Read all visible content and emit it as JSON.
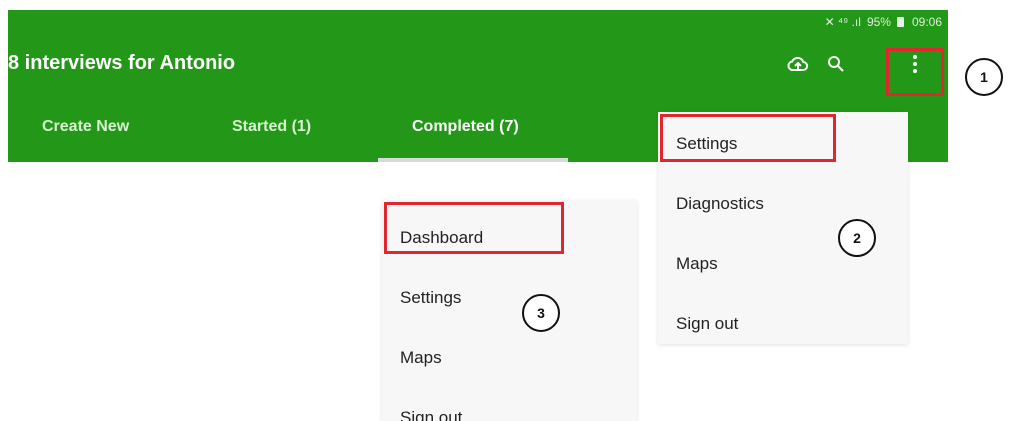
{
  "statusbar": {
    "battery": "95%",
    "time": "09:06"
  },
  "header": {
    "title": "8 interviews for Antonio"
  },
  "tabs": [
    {
      "label": "Create New"
    },
    {
      "label": "Started (1)"
    },
    {
      "label": "Completed (7)"
    }
  ],
  "overflow_menu": {
    "items": [
      "Settings",
      "Diagnostics",
      "Maps",
      "Sign out"
    ]
  },
  "completed_menu": {
    "items": [
      "Dashboard",
      "Settings",
      "Maps",
      "Sign out"
    ]
  },
  "callouts": {
    "one": "1",
    "two": "2",
    "three": "3"
  },
  "colors": {
    "appbar": "#239818",
    "highlight": "#e0262f"
  },
  "icons": [
    "cloud-sync-icon",
    "search-icon",
    "more-vert-icon",
    "signal-icon",
    "battery-icon"
  ]
}
